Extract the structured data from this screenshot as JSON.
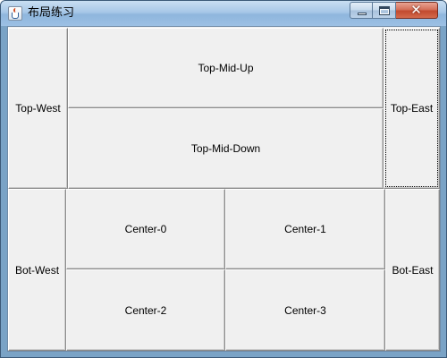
{
  "window": {
    "title": "布局练习",
    "icon": "java-cup-icon",
    "controls": {
      "minimize": "minimize-icon",
      "maximize": "maximize-icon",
      "close": "✕"
    }
  },
  "top": {
    "west": "Top-West",
    "mid_up": "Top-Mid-Up",
    "mid_down": "Top-Mid-Down",
    "east": "Top-East"
  },
  "bottom": {
    "west": "Bot-West",
    "center": [
      "Center-0",
      "Center-1",
      "Center-2",
      "Center-3"
    ],
    "east": "Bot-East"
  },
  "colors": {
    "titlebar": "#a7c7e7",
    "panel": "#f0f0f0",
    "close_button": "#c24a2f"
  }
}
